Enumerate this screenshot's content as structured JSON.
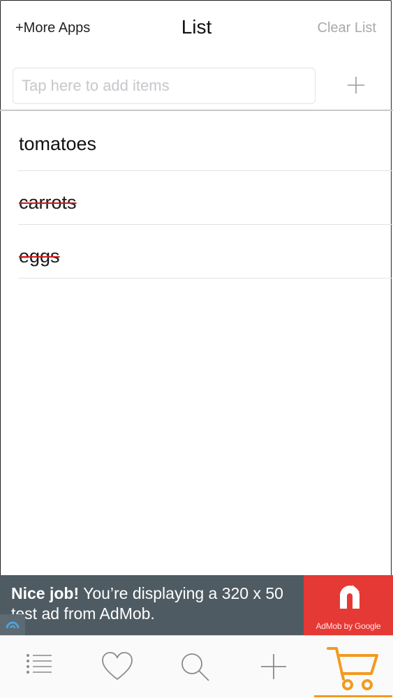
{
  "nav": {
    "more_apps": "+More Apps",
    "title": "List",
    "clear_list": "Clear List"
  },
  "add": {
    "placeholder": "Tap here to add items"
  },
  "items": [
    {
      "label": "tomatoes",
      "done": false
    },
    {
      "label": "carrots",
      "done": true
    },
    {
      "label": "eggs",
      "done": true
    }
  ],
  "ad": {
    "headline": "Nice job!",
    "body": " You’re displaying a 320 x 50 test ad from AdMob.",
    "brand_caption": "AdMob by Google"
  },
  "tabs": [
    {
      "icon": "list-icon",
      "active": false
    },
    {
      "icon": "heart-icon",
      "active": false
    },
    {
      "icon": "search-icon",
      "active": false
    },
    {
      "icon": "plus-icon",
      "active": false
    },
    {
      "icon": "cart-icon",
      "active": true
    }
  ],
  "colors": {
    "accent": "#f39a1e",
    "strike": "#d11b1b",
    "ad_bg": "#4f5b62",
    "ad_brand": "#e53935"
  }
}
